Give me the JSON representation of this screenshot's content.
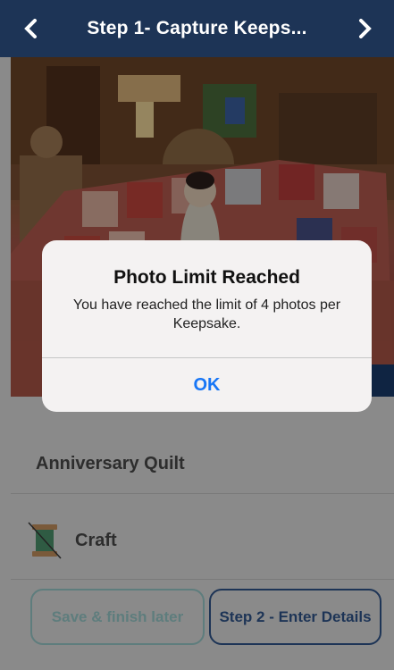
{
  "header": {
    "title": "Step 1- Capture Keeps...",
    "back_icon": "chevron-left-icon",
    "forward_icon": "chevron-right-icon"
  },
  "keepsake": {
    "name": "Anniversary Quilt",
    "category": "Craft",
    "category_icon": "thread-spool-icon"
  },
  "actions": {
    "save_label": "Save & finish later",
    "next_label": "Step 2 - Enter Details"
  },
  "alert": {
    "title": "Photo Limit Reached",
    "message": "You have reached the limit of 4 photos per Keepsake.",
    "ok_label": "OK"
  },
  "colors": {
    "header_bg": "#1d3456",
    "alert_button": "#1776f6",
    "save_border": "#5e7d7d",
    "step_border": "#1d3456"
  }
}
